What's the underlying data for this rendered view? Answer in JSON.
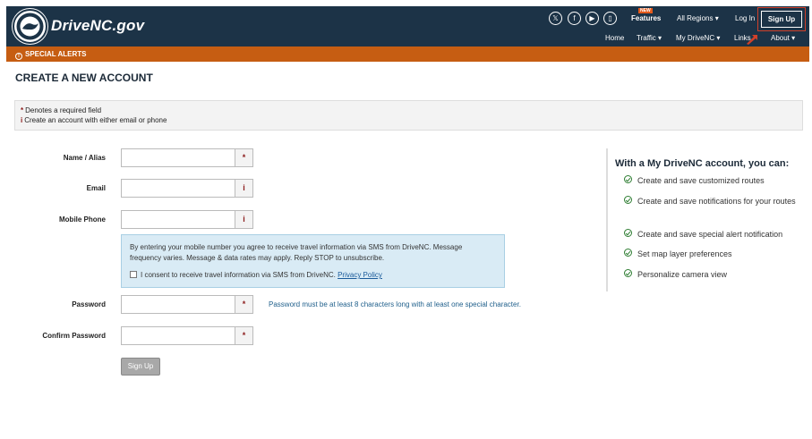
{
  "header": {
    "site_name": "DriveNC.gov",
    "social": [
      {
        "icon": "x-icon",
        "glyph": "𝕏"
      },
      {
        "icon": "facebook-icon",
        "glyph": "f"
      },
      {
        "icon": "youtube-icon",
        "glyph": "▶"
      },
      {
        "icon": "mobile-app-icon",
        "glyph": "▯"
      }
    ],
    "features_label": "Features",
    "new_badge": "NEW",
    "regions_label": "All Regions ▾",
    "login_label": "Log In",
    "signup_label": "Sign Up",
    "nav": {
      "home": "Home",
      "traffic": "Traffic ▾",
      "my_drivenc": "My DriveNC ▾",
      "links": "Links",
      "about": "About ▾"
    }
  },
  "alert_bar": {
    "label": "SPECIAL ALERTS"
  },
  "page": {
    "title": "CREATE A NEW ACCOUNT"
  },
  "info": {
    "required_mark": "*",
    "required_text": "Denotes a required field",
    "info_mark": "i",
    "info_text": "Create an account with either email or phone"
  },
  "form": {
    "name_label": "Name / Alias",
    "email_label": "Email",
    "phone_label": "Mobile Phone",
    "password_label": "Password",
    "confirm_label": "Confirm Password",
    "required_addon": "*",
    "info_addon": "i",
    "sms_notice": "By entering your mobile number you agree to receive travel information via SMS from DriveNC. Message frequency varies. Message & data rates may apply. Reply STOP to unsubscribe.",
    "sms_consent": "I consent to receive travel information via SMS from DriveNC.",
    "privacy_link": "Privacy Policy",
    "password_hint": "Password must be at least 8 characters long with at least one special character.",
    "submit_label": "Sign Up"
  },
  "benefits": {
    "title": "With a My DriveNC account, you can:",
    "items": [
      "Create and save customized routes",
      "Create and save notifications for your routes",
      "Create and save special alert notification",
      "Set map layer preferences",
      "Personalize camera view"
    ]
  },
  "colors": {
    "header_bg": "#1c3347",
    "alert_bg": "#c65d12",
    "check_green": "#2e7d32",
    "required_red": "#8b1a1a"
  }
}
